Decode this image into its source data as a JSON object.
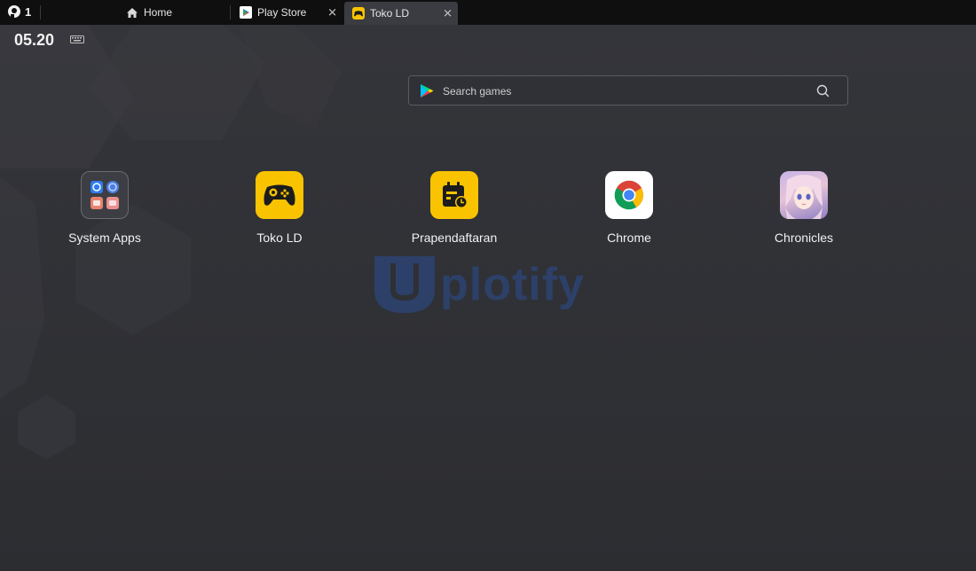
{
  "tabbar": {
    "instance_count": "1",
    "tabs": [
      {
        "label": "Home",
        "icon": "home-icon"
      },
      {
        "label": "Play Store",
        "icon": "play-store-icon"
      },
      {
        "label": "Toko LD",
        "icon": "toko-ld-icon",
        "active": true
      }
    ],
    "close_glyph": "✕"
  },
  "status": {
    "time": "05.20",
    "keyboard_icon": "keyboard-icon"
  },
  "search": {
    "placeholder": "Search games"
  },
  "apps": [
    {
      "label": "System Apps",
      "icon": "system-apps-folder-icon"
    },
    {
      "label": "Toko LD",
      "icon": "toko-ld-gamepad-icon",
      "color": "#f9c300"
    },
    {
      "label": "Prapendaftaran",
      "icon": "calendar-clock-icon",
      "color": "#f9c300"
    },
    {
      "label": "Chrome",
      "icon": "chrome-icon"
    },
    {
      "label": "Chronicles",
      "icon": "chronicles-icon"
    }
  ],
  "watermark": {
    "text": "plotify"
  },
  "colors": {
    "accent_yellow": "#f9c300",
    "tab_active_bg": "#3b3c41",
    "desktop_bg": "#2f3035"
  }
}
